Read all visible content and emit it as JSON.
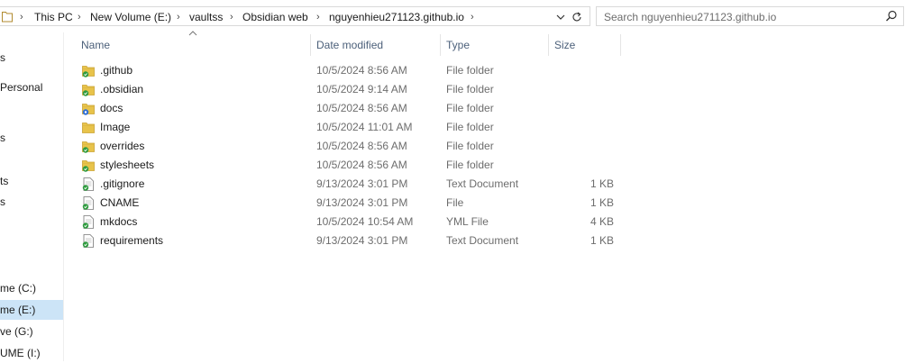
{
  "address_bar": {
    "crumbs": [
      "This PC",
      "New Volume (E:)",
      "vaultss",
      "Obsidian web",
      "nguyenhieu271123.github.io"
    ]
  },
  "search": {
    "placeholder": "Search nguyenhieu271123.github.io"
  },
  "nav": {
    "items": [
      {
        "label": "s"
      },
      {
        "label": "Personal"
      },
      {
        "label": "s"
      },
      {
        "label": "ts"
      },
      {
        "label": "s"
      },
      {
        "label": "me (C:)"
      },
      {
        "label": "me (E:)"
      },
      {
        "label": "ve (G:)"
      },
      {
        "label": "UME (I:)"
      }
    ],
    "selected_label": "me (E:)"
  },
  "columns": {
    "name": "Name",
    "date": "Date modified",
    "type": "Type",
    "size": "Size"
  },
  "files": [
    {
      "name": ".github",
      "date": "10/5/2024 8:56 AM",
      "type": "File folder",
      "size": "",
      "icon": "folder-sync-icon"
    },
    {
      "name": ".obsidian",
      "date": "10/5/2024 9:14 AM",
      "type": "File folder",
      "size": "",
      "icon": "folder-sync-icon"
    },
    {
      "name": "docs",
      "date": "10/5/2024 8:56 AM",
      "type": "File folder",
      "size": "",
      "icon": "folder-syncing-icon"
    },
    {
      "name": "Image",
      "date": "10/5/2024 11:01 AM",
      "type": "File folder",
      "size": "",
      "icon": "folder-icon"
    },
    {
      "name": "overrides",
      "date": "10/5/2024 8:56 AM",
      "type": "File folder",
      "size": "",
      "icon": "folder-sync-icon"
    },
    {
      "name": "stylesheets",
      "date": "10/5/2024 8:56 AM",
      "type": "File folder",
      "size": "",
      "icon": "folder-sync-icon"
    },
    {
      "name": ".gitignore",
      "date": "9/13/2024 3:01 PM",
      "type": "Text Document",
      "size": "1 KB",
      "icon": "document-sync-icon"
    },
    {
      "name": "CNAME",
      "date": "9/13/2024 3:01 PM",
      "type": "File",
      "size": "1 KB",
      "icon": "document-sync-icon"
    },
    {
      "name": "mkdocs",
      "date": "10/5/2024 10:54 AM",
      "type": "YML File",
      "size": "4 KB",
      "icon": "document-sync-icon"
    },
    {
      "name": "requirements",
      "date": "9/13/2024 3:01 PM",
      "type": "Text Document",
      "size": "1 KB",
      "icon": "document-sync-icon"
    }
  ],
  "colors": {
    "selection": "#cce4f7",
    "folder": "#e8c34a",
    "sync_green": "#2e9a3e",
    "syncing_blue": "#2f6fd6",
    "header_text": "#4c607a"
  }
}
